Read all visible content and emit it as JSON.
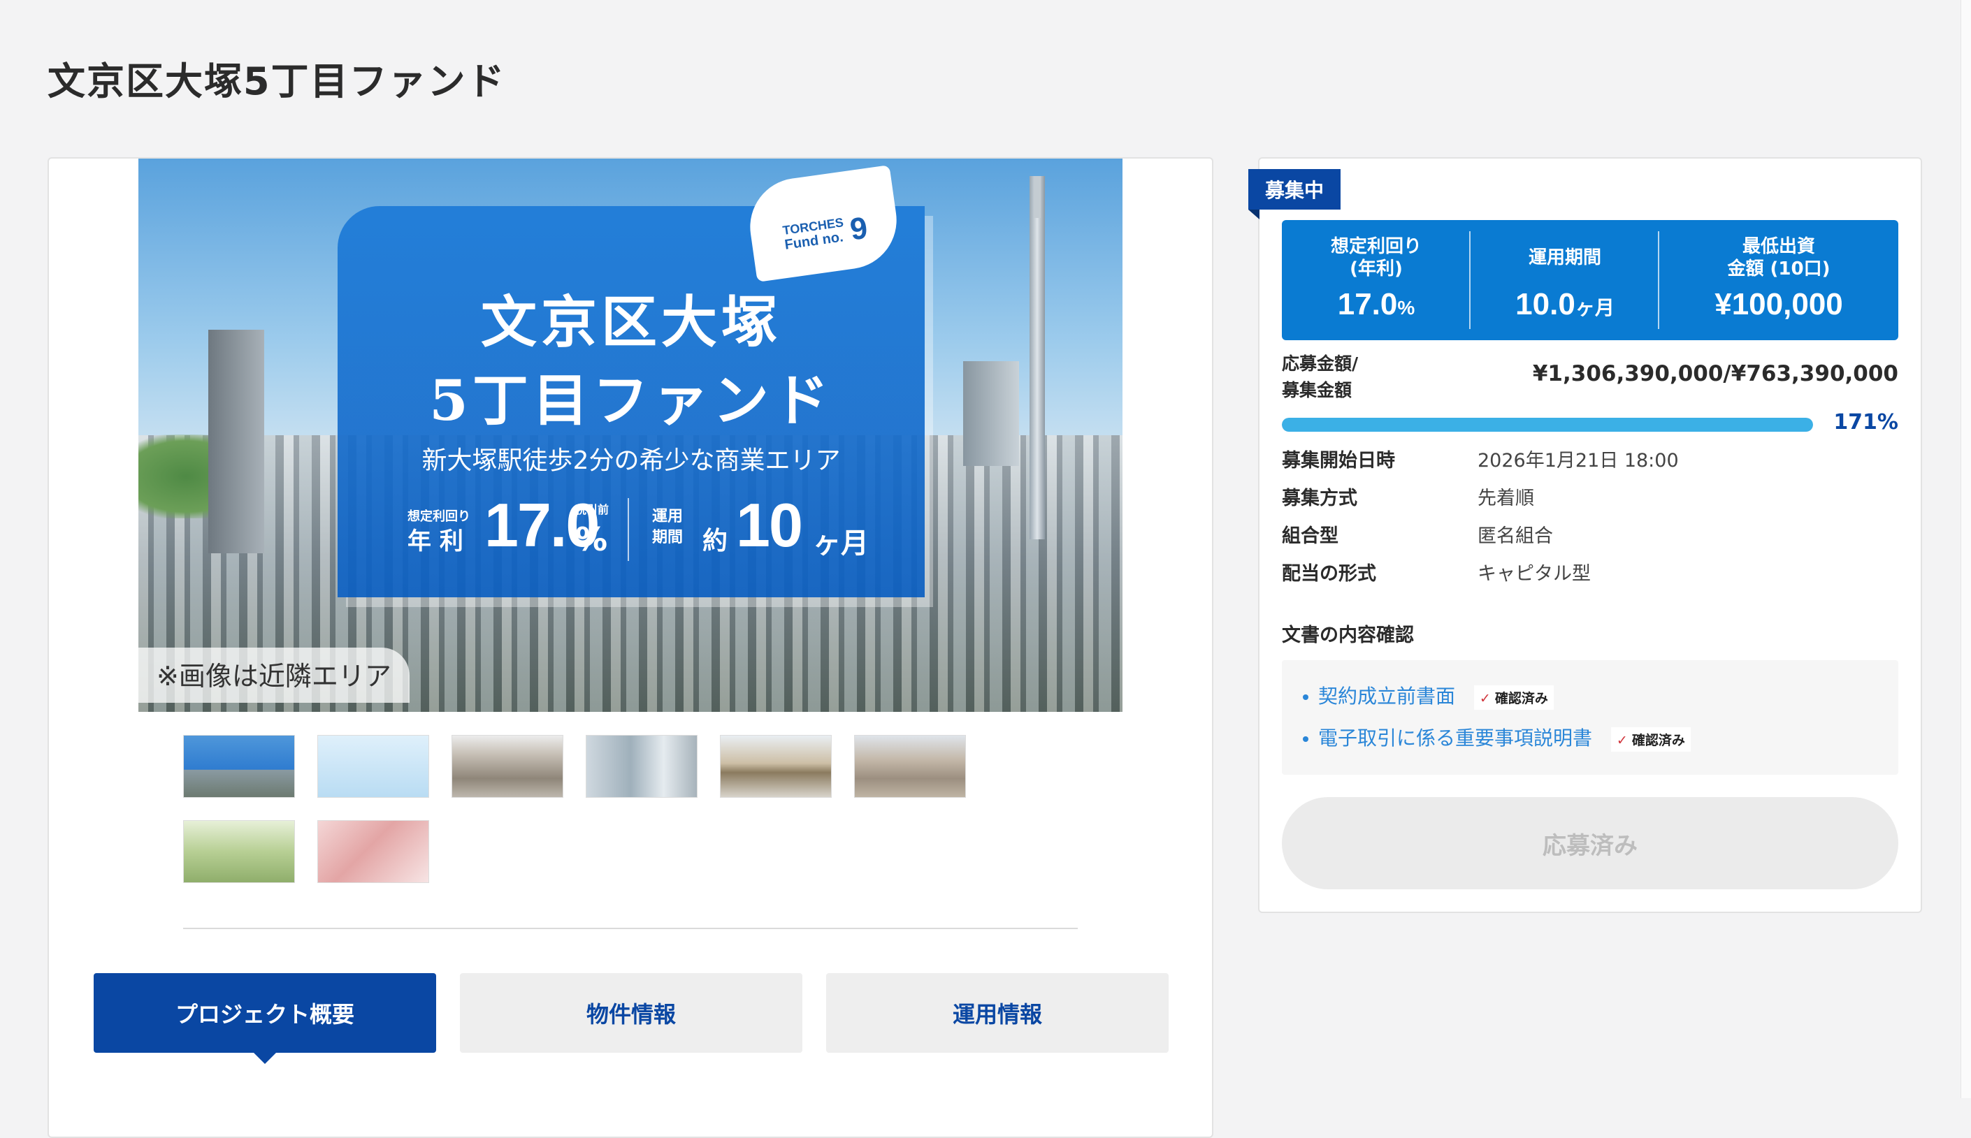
{
  "page": {
    "title": "文京区大塚5丁目ファンド"
  },
  "hero": {
    "fund_tag_line1": "TORCHES",
    "fund_tag_line2": "Fund no.",
    "fund_tag_number": "9",
    "title_line1": "文京区大塚",
    "title_line2": "5丁目ファンド",
    "subtitle": "新大塚駅徒歩2分の希少な商業エリア",
    "yield_label": "想定利回り",
    "yield_label2": "年 利",
    "yield_value": "17.0",
    "yield_unit": "%",
    "tax_note": "税引前",
    "period_label": "運用",
    "period_label2": "期間",
    "period_prefix": "約",
    "period_value": "10",
    "period_unit": "ヶ月",
    "photo_note": "※画像は近隣エリア"
  },
  "thumbnails": [
    "thumb-1",
    "thumb-2",
    "thumb-3",
    "thumb-4",
    "thumb-5",
    "thumb-6",
    "thumb-7",
    "thumb-8"
  ],
  "tabs": [
    {
      "label": "プロジェクト概要",
      "active": true
    },
    {
      "label": "物件情報",
      "active": false
    },
    {
      "label": "運用情報",
      "active": false
    }
  ],
  "sidebar": {
    "status": "募集中",
    "stats": [
      {
        "label": "想定利回り\n(年利)",
        "value": "17.0",
        "unit": "%"
      },
      {
        "label": "運用期間",
        "value": "10.0",
        "unit": "ヶ月"
      },
      {
        "label": "最低出資\n金額 (10口)",
        "value": "¥100,000",
        "unit": ""
      }
    ],
    "amount_label_1": "応募金額/",
    "amount_label_2": "募集金額",
    "amount_value": "¥1,306,390,000/¥763,390,000",
    "progress_percent": 171,
    "progress_text": "171%",
    "info": [
      {
        "key": "募集開始日時",
        "value": "2026年1月21日 18:00"
      },
      {
        "key": "募集方式",
        "value": "先着順"
      },
      {
        "key": "組合型",
        "value": "匿名組合"
      },
      {
        "key": "配当の形式",
        "value": "キャピタル型"
      }
    ],
    "documents_heading": "文書の内容確認",
    "documents": [
      {
        "label": "契約成立前書面",
        "status": "確認済み"
      },
      {
        "label": "電子取引に係る重要事項説明書",
        "status": "確認済み"
      }
    ],
    "apply_button": "応募済み"
  },
  "colors": {
    "brand_dark": "#0a47a3",
    "stats_blue": "#0a7bd2",
    "progress": "#3bb0e6",
    "link": "#2a86d8"
  }
}
